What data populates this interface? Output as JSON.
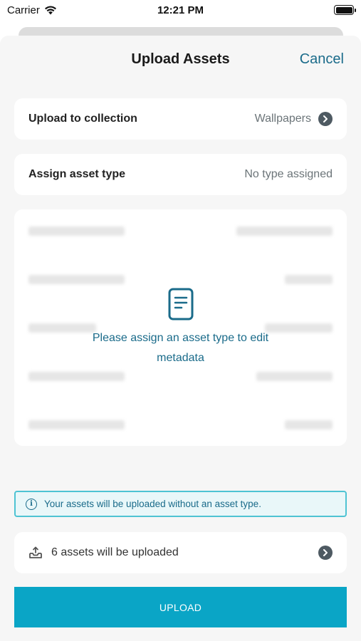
{
  "status_bar": {
    "carrier": "Carrier",
    "time": "12:21 PM"
  },
  "nav": {
    "title": "Upload Assets",
    "cancel_label": "Cancel"
  },
  "collection": {
    "label": "Upload to collection",
    "value": "Wallpapers"
  },
  "asset_type": {
    "label": "Assign asset type",
    "value": "No type assigned"
  },
  "metadata": {
    "message": "Please assign an asset type to edit metadata"
  },
  "info_banner": {
    "text": "Your assets will be uploaded without an asset type."
  },
  "upload_summary": {
    "text": "6 assets will be uploaded"
  },
  "upload_button": {
    "label": "UPLOAD"
  },
  "colors": {
    "accent": "#0aa5c6",
    "link": "#1a6b8a",
    "banner_border": "#4ec3d3",
    "background": "#f6f6f6"
  }
}
